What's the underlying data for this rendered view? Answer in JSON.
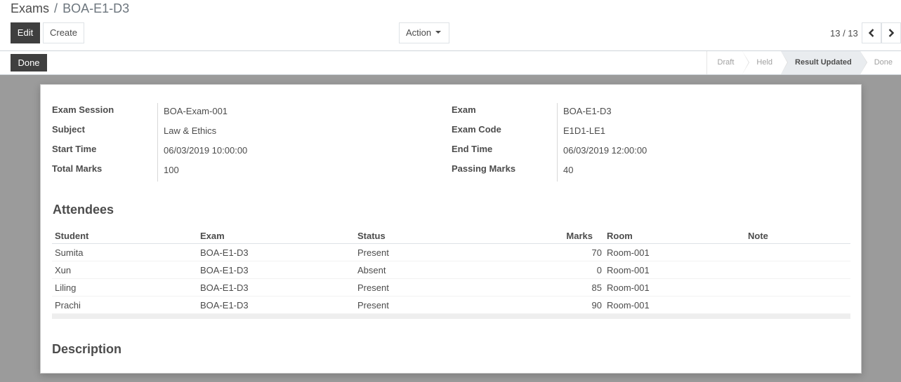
{
  "breadcrumb": {
    "parent": "Exams",
    "separator": "/",
    "current": "BOA-E1-D3"
  },
  "toolbar": {
    "edit_label": "Edit",
    "create_label": "Create",
    "action_label": "Action"
  },
  "pager": {
    "value": "13 / 13"
  },
  "statusbar": {
    "done_label": "Done",
    "stages": [
      {
        "label": "Draft",
        "active": false
      },
      {
        "label": "Held",
        "active": false
      },
      {
        "label": "Result Updated",
        "active": true
      },
      {
        "label": "Done",
        "active": false
      }
    ]
  },
  "form": {
    "left": [
      {
        "label": "Exam Session",
        "value": "BOA-Exam-001"
      },
      {
        "label": "Subject",
        "value": "Law & Ethics"
      },
      {
        "label": "Start Time",
        "value": "06/03/2019 10:00:00"
      },
      {
        "label": "Total Marks",
        "value": "100"
      }
    ],
    "right": [
      {
        "label": "Exam",
        "value": "BOA-E1-D3"
      },
      {
        "label": "Exam Code",
        "value": "E1D1-LE1"
      },
      {
        "label": "End Time",
        "value": "06/03/2019 12:00:00"
      },
      {
        "label": "Passing Marks",
        "value": "40"
      }
    ]
  },
  "attendees": {
    "title": "Attendees",
    "columns": {
      "student": "Student",
      "exam": "Exam",
      "status": "Status",
      "marks": "Marks",
      "room": "Room",
      "note": "Note"
    },
    "rows": [
      {
        "student": "Sumita",
        "exam": "BOA-E1-D3",
        "status": "Present",
        "marks": "70",
        "room": "Room-001",
        "note": ""
      },
      {
        "student": "Xun",
        "exam": "BOA-E1-D3",
        "status": "Absent",
        "marks": "0",
        "room": "Room-001",
        "note": ""
      },
      {
        "student": "Liling",
        "exam": "BOA-E1-D3",
        "status": "Present",
        "marks": "85",
        "room": "Room-001",
        "note": ""
      },
      {
        "student": "Prachi",
        "exam": "BOA-E1-D3",
        "status": "Present",
        "marks": "90",
        "room": "Room-001",
        "note": ""
      }
    ]
  },
  "description": {
    "title": "Description"
  },
  "colors": {
    "dark_button": "#3f3f3f",
    "background": "#9b9b9b",
    "active_stage": "#e9ecef"
  },
  "icons": {
    "prev": "chevron-left-icon",
    "next": "chevron-right-icon",
    "dropdown": "caret-down-icon"
  }
}
